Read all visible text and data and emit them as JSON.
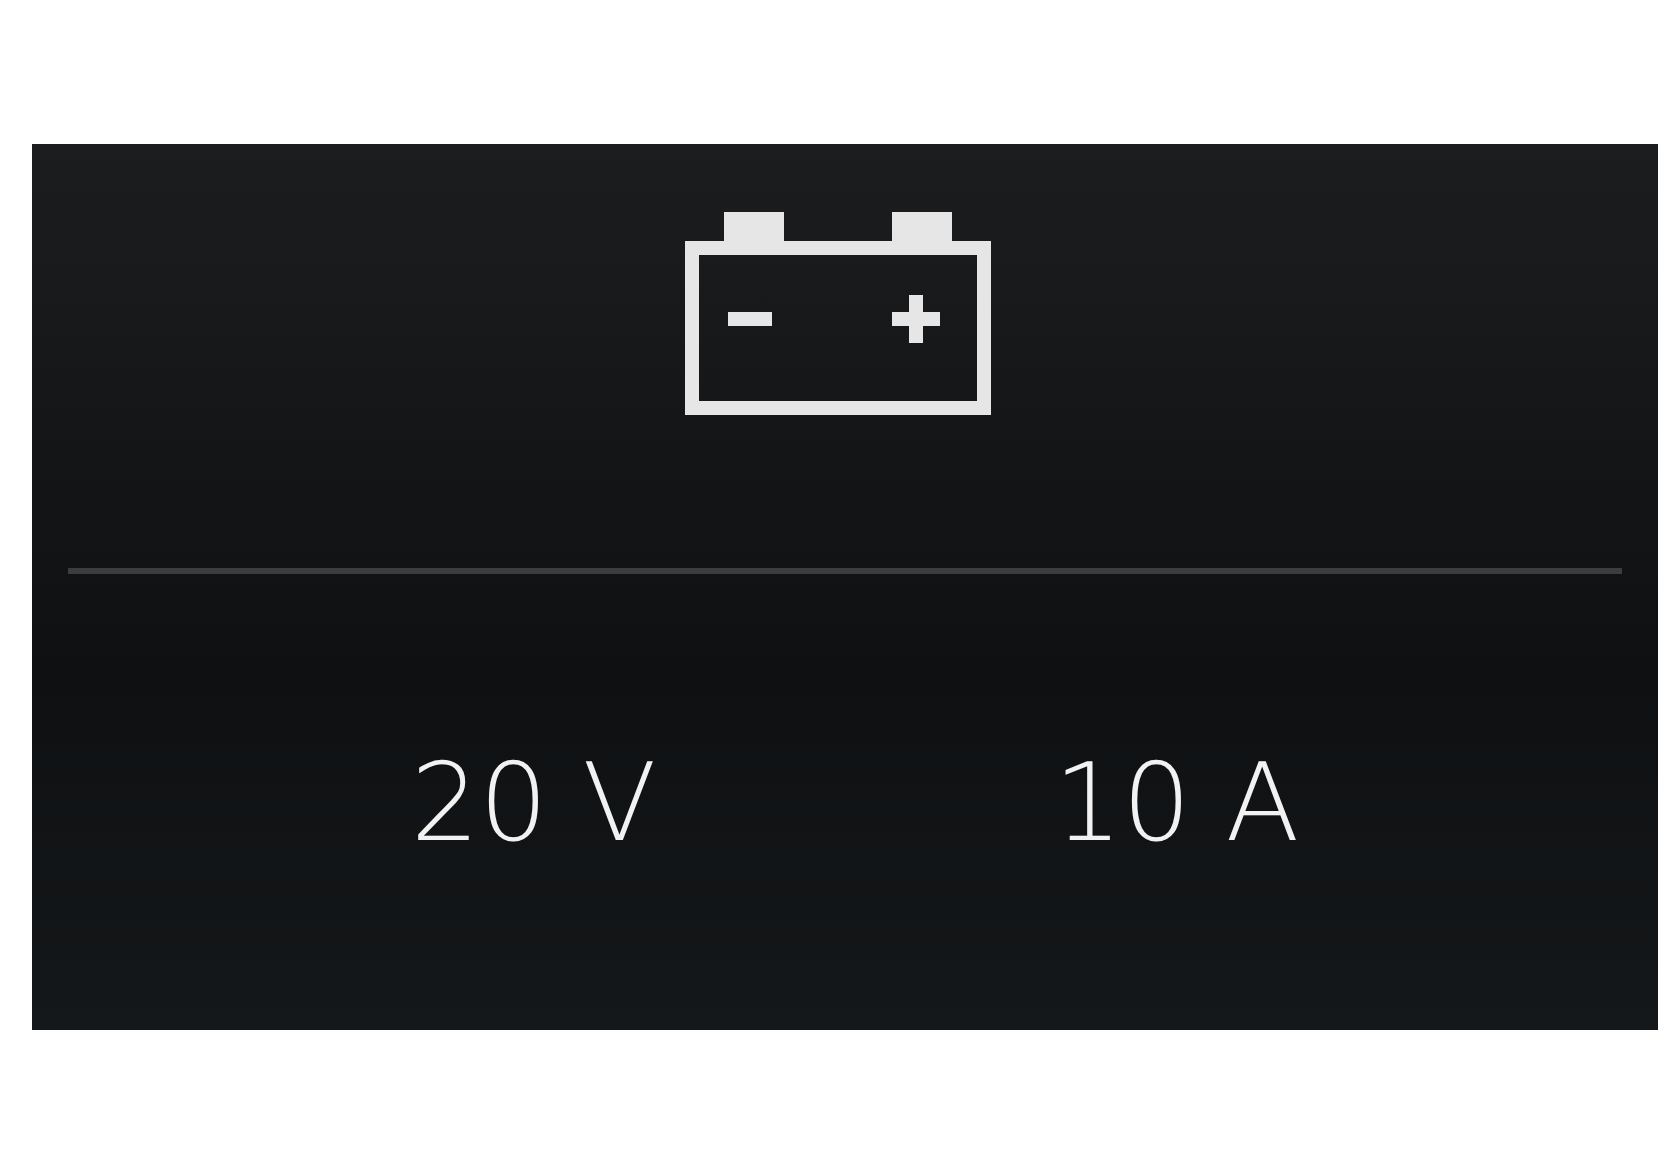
{
  "readings": [
    {
      "text": "20 V"
    },
    {
      "text": "10 A"
    }
  ]
}
